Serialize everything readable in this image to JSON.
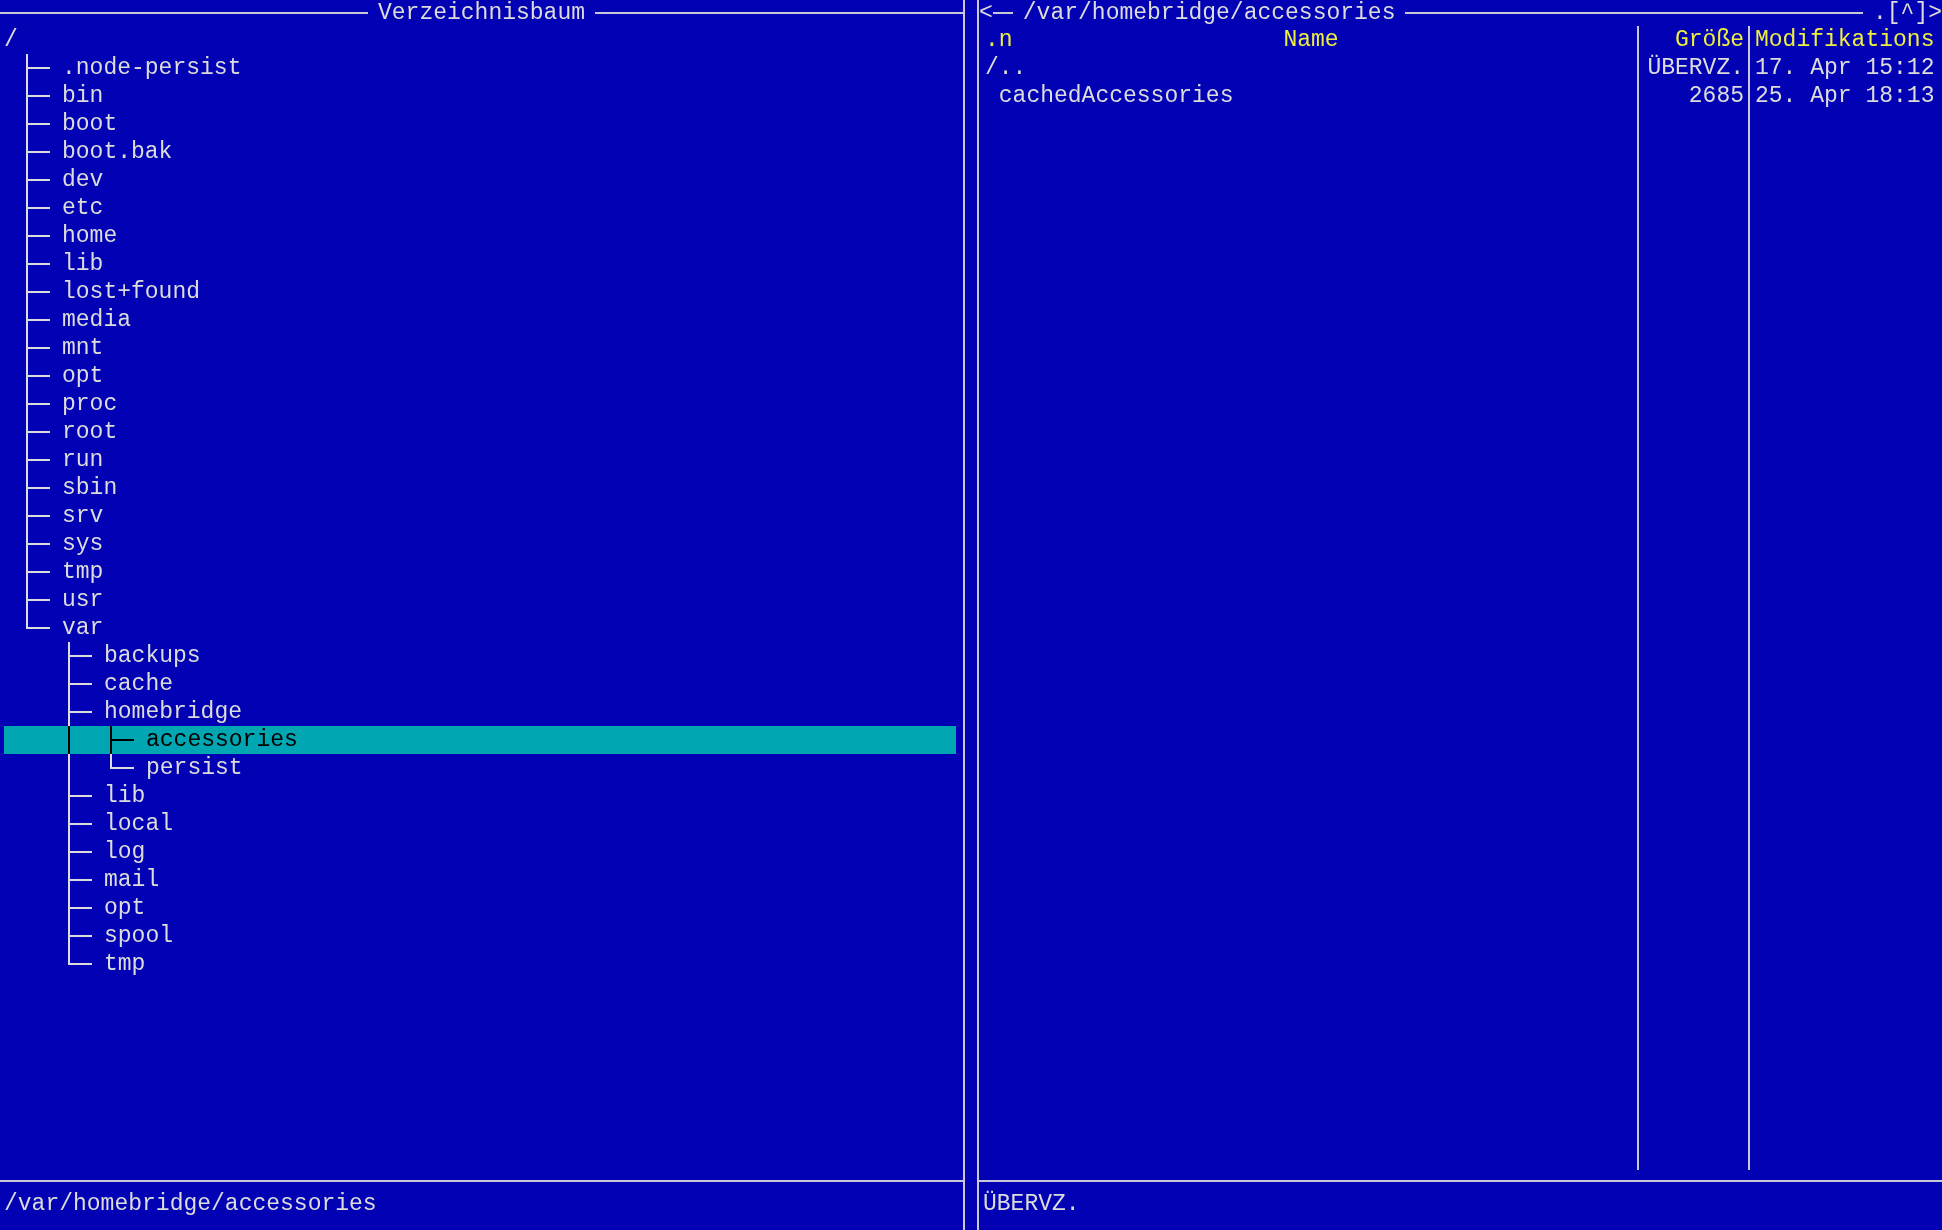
{
  "left_panel": {
    "title": "Verzeichnisbaum",
    "tree": {
      "name": "/",
      "selected": false,
      "children": [
        {
          "name": ".node-persist",
          "selected": false
        },
        {
          "name": "bin",
          "selected": false
        },
        {
          "name": "boot",
          "selected": false
        },
        {
          "name": "boot.bak",
          "selected": false
        },
        {
          "name": "dev",
          "selected": false
        },
        {
          "name": "etc",
          "selected": false
        },
        {
          "name": "home",
          "selected": false
        },
        {
          "name": "lib",
          "selected": false
        },
        {
          "name": "lost+found",
          "selected": false
        },
        {
          "name": "media",
          "selected": false
        },
        {
          "name": "mnt",
          "selected": false
        },
        {
          "name": "opt",
          "selected": false
        },
        {
          "name": "proc",
          "selected": false
        },
        {
          "name": "root",
          "selected": false
        },
        {
          "name": "run",
          "selected": false
        },
        {
          "name": "sbin",
          "selected": false
        },
        {
          "name": "srv",
          "selected": false
        },
        {
          "name": "sys",
          "selected": false
        },
        {
          "name": "tmp",
          "selected": false
        },
        {
          "name": "usr",
          "selected": false
        },
        {
          "name": "var",
          "selected": false,
          "children": [
            {
              "name": "backups",
              "selected": false
            },
            {
              "name": "cache",
              "selected": false
            },
            {
              "name": "homebridge",
              "selected": false,
              "children": [
                {
                  "name": "accessories",
                  "selected": true
                },
                {
                  "name": "persist",
                  "selected": false
                }
              ]
            },
            {
              "name": "lib",
              "selected": false
            },
            {
              "name": "local",
              "selected": false
            },
            {
              "name": "log",
              "selected": false
            },
            {
              "name": "mail",
              "selected": false
            },
            {
              "name": "opt",
              "selected": false
            },
            {
              "name": "spool",
              "selected": false
            },
            {
              "name": "tmp",
              "selected": false
            }
          ]
        }
      ]
    },
    "status": "/var/homebridge/accessories"
  },
  "right_panel": {
    "nav_left": "<",
    "path": "/var/homebridge/accessories",
    "nav_right": ".[^]>",
    "sort_indicator": ".n",
    "columns": [
      "Name",
      "Größe",
      "Modifikations"
    ],
    "rows": [
      {
        "kind": "parent",
        "name": "/..",
        "size": "ÜBERVZ.",
        "modified": "17. Apr 15:12"
      },
      {
        "kind": "file",
        "name": "cachedAccessories",
        "size": "2685",
        "modified": "25. Apr 18:13"
      }
    ],
    "status": "ÜBERVZ."
  }
}
